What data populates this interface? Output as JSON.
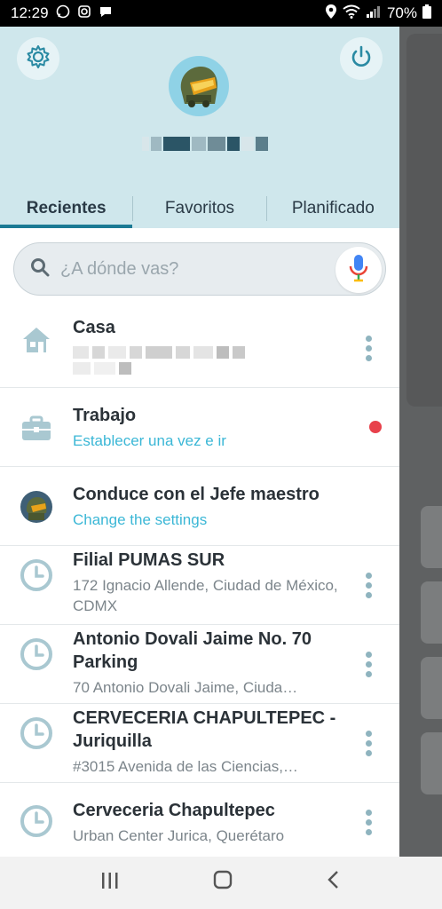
{
  "status_bar": {
    "time": "12:29",
    "battery": "70%"
  },
  "tabs": [
    {
      "label": "Recientes"
    },
    {
      "label": "Favoritos"
    },
    {
      "label": "Planificado"
    }
  ],
  "search": {
    "placeholder": "¿A dónde vas?"
  },
  "items": [
    {
      "title": "Casa",
      "subtitle": ""
    },
    {
      "title": "Trabajo",
      "subtitle": "Establecer una vez e ir"
    },
    {
      "title": "Conduce con el Jefe maestro",
      "subtitle": "Change the settings"
    },
    {
      "title": "Filial PUMAS SUR",
      "subtitle": "172 Ignacio Allende, Ciudad de México, CDMX"
    },
    {
      "title": "Antonio Dovali Jaime No. 70 Parking",
      "subtitle": "70 Antonio Dovali Jaime, Ciuda…"
    },
    {
      "title": "CERVECERIA CHAPULTEPEC - Juriquilla",
      "subtitle": "#3015 Avenida de las Ciencias,…"
    },
    {
      "title": "Cerveceria Chapultepec",
      "subtitle": "Urban Center Jurica, Querétaro"
    }
  ],
  "colors": {
    "header_bg": "#cfe7ec",
    "accent": "#1b7a94",
    "link": "#3bb7d6",
    "notification_dot": "#e8414b"
  },
  "icons": [
    "settings-gear-icon",
    "power-icon",
    "search-icon",
    "microphone-icon",
    "home-icon",
    "briefcase-icon",
    "clock-icon",
    "more-vert-icon"
  ]
}
